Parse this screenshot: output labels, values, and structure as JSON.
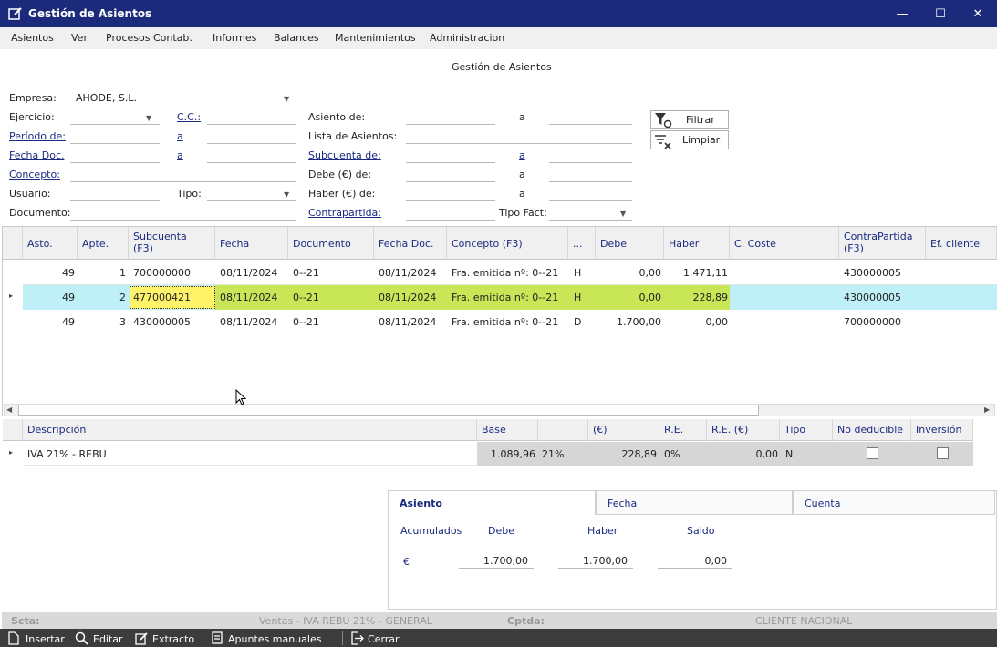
{
  "window": {
    "title": "Gestión de Asientos",
    "controls": {
      "minimize": "—",
      "maximize": "☐",
      "close": "✕"
    }
  },
  "menu": [
    "Asientos",
    "Ver",
    "Procesos Contab.",
    "Informes",
    "Balances",
    "Mantenimientos",
    "Administracion"
  ],
  "page_heading": "Gestión de Asientos",
  "filters": {
    "empresa_label": "Empresa:",
    "empresa_value": "AHODE, S.L.",
    "ejercicio_label": "Ejercicio:",
    "cc_label": "C.C.:",
    "periodo_label": "Período de:",
    "a_label": "a",
    "fechadoc_label": "Fecha Doc.",
    "concepto_label": "Concepto:",
    "usuario_label": "Usuario:",
    "tipo_label": "Tipo:",
    "documento_label": "Documento:",
    "asiento_de_label": "Asiento de:",
    "lista_label": "Lista de Asientos:",
    "subcuenta_label": "Subcuenta de:",
    "debe_label": "Debe (€) de:",
    "haber_label": "Haber (€) de:",
    "contrapartida_label": "Contrapartida:",
    "tipofact_label": "Tipo Fact:",
    "filtrar_button": "Filtrar",
    "limpiar_button": "Limpiar"
  },
  "entries_table": {
    "columns": [
      "Asto.",
      "Apte.",
      "Subcuenta (F3)",
      "Fecha",
      "Documento",
      "Fecha Doc.",
      "Concepto (F3)",
      "...",
      "Debe",
      "Haber",
      "C. Coste",
      "ContraPartida (F3)",
      "Ef. cliente"
    ],
    "rows": [
      {
        "asto": "49",
        "apte": "1",
        "subcuenta": "700000000",
        "fecha": "08/11/2024",
        "documento": "0--21",
        "fecha_doc": "08/11/2024",
        "concepto": "Fra. emitida nº: 0--21",
        "dh": "H",
        "debe": "0,00",
        "haber": "1.471,11",
        "ccoste": "",
        "contrapartida": "430000005",
        "efcliente": ""
      },
      {
        "asto": "49",
        "apte": "2",
        "subcuenta": "477000421",
        "fecha": "08/11/2024",
        "documento": "0--21",
        "fecha_doc": "08/11/2024",
        "concepto": "Fra. emitida nº: 0--21",
        "dh": "H",
        "debe": "0,00",
        "haber": "228,89",
        "ccoste": "",
        "contrapartida": "430000005",
        "efcliente": ""
      },
      {
        "asto": "49",
        "apte": "3",
        "subcuenta": "430000005",
        "fecha": "08/11/2024",
        "documento": "0--21",
        "fecha_doc": "08/11/2024",
        "concepto": "Fra. emitida nº: 0--21",
        "dh": "D",
        "debe": "1.700,00",
        "haber": "0,00",
        "ccoste": "",
        "contrapartida": "700000000",
        "efcliente": ""
      }
    ],
    "selected_row": 2
  },
  "vat_table": {
    "columns": [
      "Descripción",
      "Base",
      "",
      "(€)",
      "R.E.",
      "R.E. (€)",
      "Tipo",
      "No deducible",
      "Inversión"
    ],
    "rows": [
      {
        "descripcion": "IVA 21% - REBU",
        "base": "1.089,96",
        "pct": "21%",
        "cuota": "228,89",
        "re": "0%",
        "re_eur": "0,00",
        "tipo": "N",
        "no_deducible": false,
        "inversion": false
      }
    ]
  },
  "totals_tabs": [
    "Asiento",
    "Fecha",
    "Cuenta"
  ],
  "active_tab": "Asiento",
  "totals": {
    "acumulados_label": "Acumulados",
    "debe_label": "Debe",
    "haber_label": "Haber",
    "saldo_label": "Saldo",
    "currency": "€",
    "debe": "1.700,00",
    "haber": "1.700,00",
    "saldo": "0,00"
  },
  "status": {
    "scta_label": "Scta:",
    "scta_value": "Ventas - IVA REBU 21% - GENERAL",
    "cptda_label": "Cptda:",
    "cptda_value": "CLIENTE NACIONAL"
  },
  "toolbar": {
    "insertar": "Insertar",
    "editar": "Editar",
    "extracto": "Extracto",
    "apuntes": "Apuntes manuales IVA",
    "cerrar": "Cerrar"
  },
  "colors": {
    "titlebar": "#1b2a7a",
    "selected_row": "#bff0f8",
    "highlight": "#c8e655",
    "yellow_cell": "#fff36a"
  }
}
